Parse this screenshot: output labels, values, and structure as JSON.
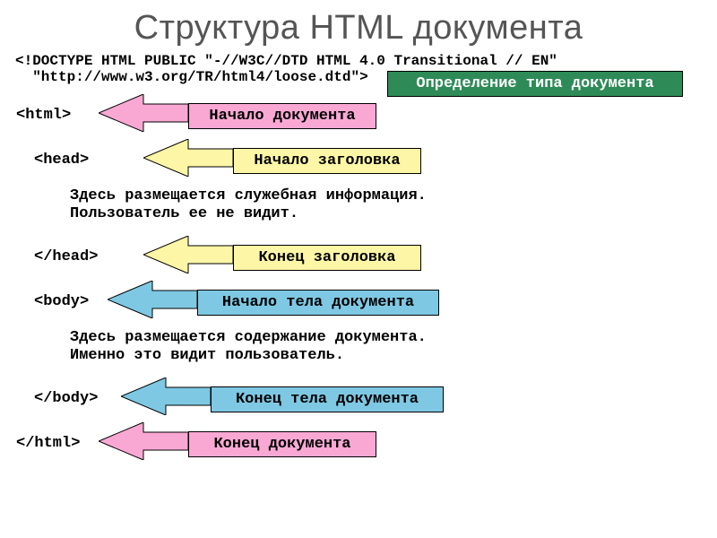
{
  "title": "Структура HTML документа",
  "doctype_line1": "<!DOCTYPE HTML PUBLIC \"-//W3C//DTD HTML 4.0 Transitional // EN\"",
  "doctype_line2": "  \"http://www.w3.org/TR/html4/loose.dtd\">",
  "code": {
    "html_open": "<html>",
    "head_open": "<head>",
    "head_text1": "Здесь размещается служебная информация.",
    "head_text2": "Пользователь ее не видит.",
    "head_close": "</head>",
    "body_open": "<body>",
    "body_text1": "Здесь размещается содержание документа.",
    "body_text2": "Именно это видит пользователь.",
    "body_close": "</body>",
    "html_close": "</html>"
  },
  "labels": {
    "doctype_def": "Определение типа документа",
    "doc_start": "Начало документа",
    "head_start": "Начало заголовка",
    "head_end": "Конец заголовка",
    "body_start": "Начало тела документа",
    "body_end": "Конец тела документа",
    "doc_end": "Конец документа"
  },
  "colors": {
    "green": "#2e8b57",
    "pink": "#f9a8d4",
    "yellow": "#fdf6a6",
    "blue": "#7ec8e3"
  }
}
